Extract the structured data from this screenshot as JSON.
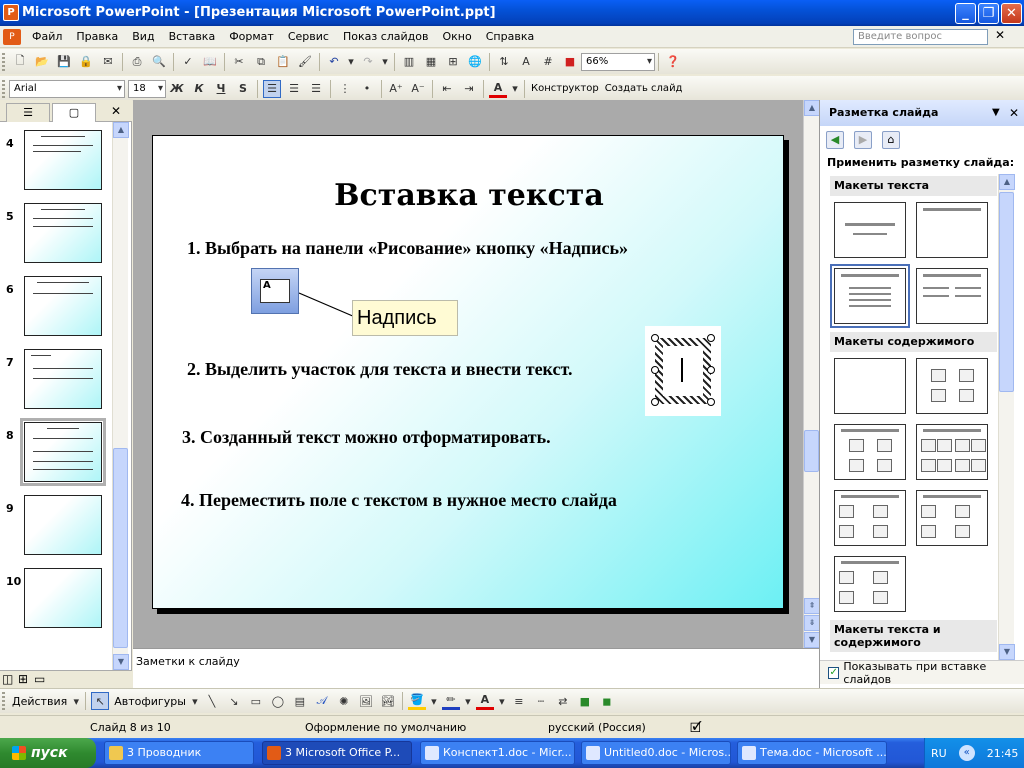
{
  "window": {
    "title": "Microsoft PowerPoint - [Презентация Microsoft PowerPoint.ppt]"
  },
  "menu": {
    "items": [
      "Файл",
      "Правка",
      "Вид",
      "Вставка",
      "Формат",
      "Сервис",
      "Показ слайдов",
      "Окно",
      "Справка"
    ],
    "ask_placeholder": "Введите вопрос"
  },
  "toolbar": {
    "zoom": "66%"
  },
  "format_toolbar": {
    "font": "Arial",
    "size": "18",
    "bold": "Ж",
    "italic": "К",
    "underline": "Ч",
    "shadow": "S",
    "designer": "Конструктор",
    "new_slide": "Создать слайд"
  },
  "slides_pane": {
    "numbers": [
      "4",
      "5",
      "6",
      "7",
      "8",
      "9",
      "10"
    ],
    "selected": "8"
  },
  "slide": {
    "title": "Вставка текста",
    "bullets": [
      "1.  Выбрать на панели «Рисование» кнопку «Надпись»",
      "2. Выделить участок для текста и внести текст.",
      "3. Созданный текст можно отформатировать.",
      "4. Переместить поле с текстом в нужное место слайда"
    ],
    "callout": "Надпись"
  },
  "notes": {
    "placeholder": "Заметки к слайду"
  },
  "taskpane": {
    "title": "Разметка слайда",
    "apply_label": "Применить разметку слайда:",
    "sections": [
      "Макеты текста",
      "Макеты содержимого",
      "Макеты текста и содержимого"
    ],
    "show_on_insert": "Показывать при вставке слайдов"
  },
  "drawing": {
    "actions": "Действия",
    "autoshapes": "Автофигуры"
  },
  "status": {
    "slide": "Слайд 8 из 10",
    "design": "Оформление по умолчанию",
    "language": "русский (Россия)"
  },
  "taskbar": {
    "start": "пуск",
    "tasks": [
      "3 Проводник",
      "3 Microsoft Office P...",
      "Конспект1.doc - Micr...",
      "Untitled0.doc - Micros...",
      "Тема.doc - Microsoft ..."
    ],
    "lang": "RU",
    "clock": "21:45"
  }
}
